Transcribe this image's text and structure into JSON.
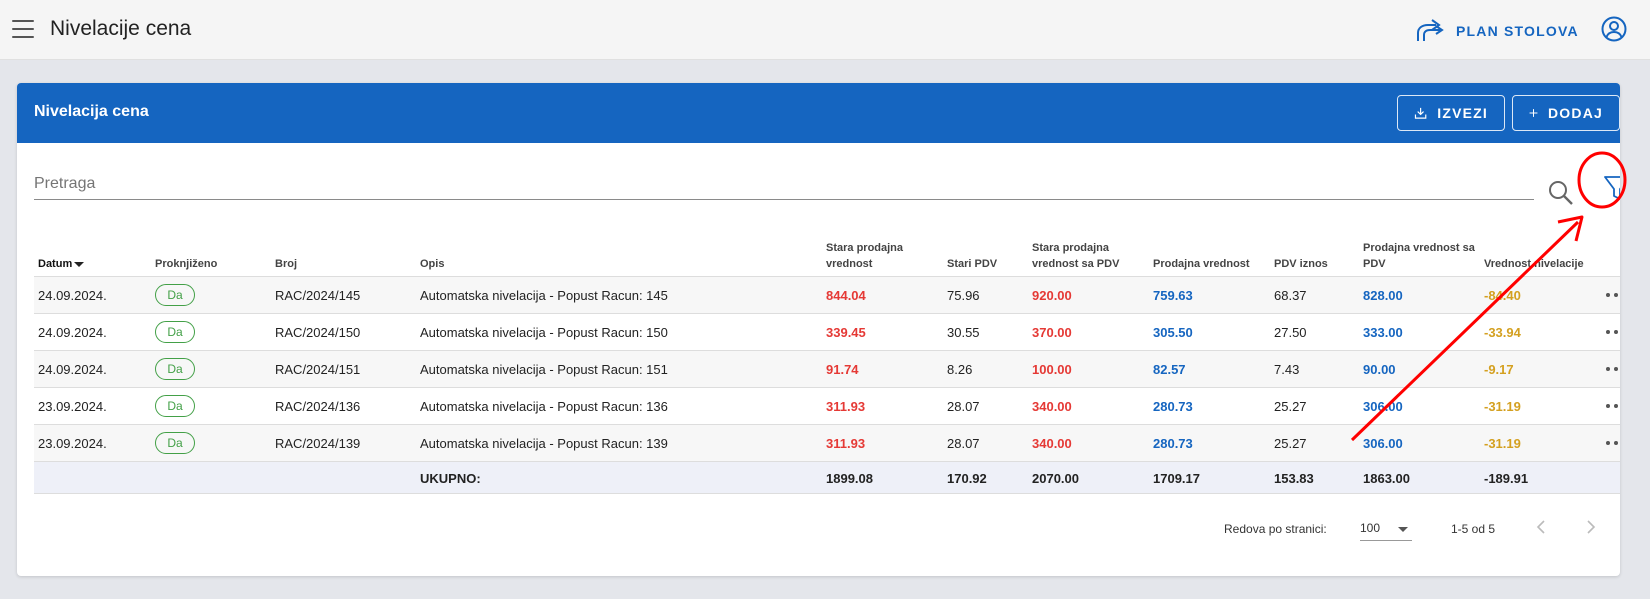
{
  "app_title": "Nivelacije cena",
  "plan_button": "PLAN STOLOVA",
  "card": {
    "title": "Nivelacija cena",
    "export_label": "IZVEZI",
    "add_label": "DODAJ"
  },
  "search": {
    "placeholder": "Pretraga"
  },
  "table": {
    "headers": {
      "datum": "Datum",
      "proknjizeno": "Proknjiženo",
      "broj": "Broj",
      "opis": "Opis",
      "stara_prodajna": "Stara prodajna vrednost",
      "stari_pdv": "Stari PDV",
      "stara_sa_pdv": "Stara prodajna vrednost sa PDV",
      "prodajna": "Prodajna vrednost",
      "pdv_iznos": "PDV iznos",
      "prodajna_sa_pdv": "Prodajna vrednost sa PDV",
      "vrednost_nivelacije": "Vrednost nivelacije"
    },
    "rows": [
      {
        "datum": "24.09.2024.",
        "proknjizeno": "Da",
        "broj": "RAC/2024/145",
        "opis": "Automatska nivelacija - Popust Racun: 145",
        "stara": "844.04",
        "stari_pdv": "75.96",
        "stara_sa_pdv": "920.00",
        "prodajna": "759.63",
        "pdv": "68.37",
        "prodajna_sa_pdv": "828.00",
        "nivelacija": "-84.40"
      },
      {
        "datum": "24.09.2024.",
        "proknjizeno": "Da",
        "broj": "RAC/2024/150",
        "opis": "Automatska nivelacija - Popust Racun: 150",
        "stara": "339.45",
        "stari_pdv": "30.55",
        "stara_sa_pdv": "370.00",
        "prodajna": "305.50",
        "pdv": "27.50",
        "prodajna_sa_pdv": "333.00",
        "nivelacija": "-33.94"
      },
      {
        "datum": "24.09.2024.",
        "proknjizeno": "Da",
        "broj": "RAC/2024/151",
        "opis": "Automatska nivelacija - Popust Racun: 151",
        "stara": "91.74",
        "stari_pdv": "8.26",
        "stara_sa_pdv": "100.00",
        "prodajna": "82.57",
        "pdv": "7.43",
        "prodajna_sa_pdv": "90.00",
        "nivelacija": "-9.17"
      },
      {
        "datum": "23.09.2024.",
        "proknjizeno": "Da",
        "broj": "RAC/2024/136",
        "opis": "Automatska nivelacija - Popust Racun: 136",
        "stara": "311.93",
        "stari_pdv": "28.07",
        "stara_sa_pdv": "340.00",
        "prodajna": "280.73",
        "pdv": "25.27",
        "prodajna_sa_pdv": "306.00",
        "nivelacija": "-31.19"
      },
      {
        "datum": "23.09.2024.",
        "proknjizeno": "Da",
        "broj": "RAC/2024/139",
        "opis": "Automatska nivelacija - Popust Racun: 139",
        "stara": "311.93",
        "stari_pdv": "28.07",
        "stara_sa_pdv": "340.00",
        "prodajna": "280.73",
        "pdv": "25.27",
        "prodajna_sa_pdv": "306.00",
        "nivelacija": "-31.19"
      }
    ],
    "totals": {
      "label": "UKUPNO:",
      "stara": "1899.08",
      "stari_pdv": "170.92",
      "stara_sa_pdv": "2070.00",
      "prodajna": "1709.17",
      "pdv": "153.83",
      "prodajna_sa_pdv": "1863.00",
      "nivelacija": "-189.91"
    }
  },
  "pagination": {
    "rows_per_page_label": "Redova po stranici:",
    "rows_per_page_value": "100",
    "range": "1-5 od 5"
  },
  "colors": {
    "primary": "#1565c0",
    "old_value": "#e53935",
    "new_value": "#1565c0",
    "leveling": "#d4a020",
    "posted_badge": "#43a047",
    "annotation": "#ff0000"
  }
}
